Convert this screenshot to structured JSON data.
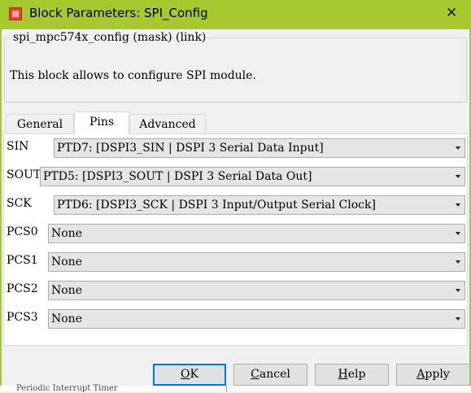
{
  "window": {
    "title": "Block Parameters: SPI_Config",
    "close_glyph": "✕"
  },
  "mask": {
    "group_title": "spi_mpc574x_config (mask) (link)",
    "description": "This block allows to configure SPI module."
  },
  "tabs": [
    {
      "label": "General",
      "active": false
    },
    {
      "label": "Pins",
      "active": true
    },
    {
      "label": "Advanced",
      "active": false
    }
  ],
  "pins": [
    {
      "label": "SIN",
      "value": "PTD7: [DSPI3_SIN | DSPI 3 Serial Data Input]"
    },
    {
      "label": "SOUT",
      "value": "PTD5: [DSPI3_SOUT | DSPI 3 Serial Data Out]"
    },
    {
      "label": "SCK",
      "value": "PTD6: [DSPI3_SCK | DSPI 3 Input/Output Serial Clock]"
    },
    {
      "label": "PCS0",
      "value": "None"
    },
    {
      "label": "PCS1",
      "value": "None"
    },
    {
      "label": "PCS2",
      "value": "None"
    },
    {
      "label": "PCS3",
      "value": "None"
    }
  ],
  "buttons": {
    "ok": {
      "mnemonic": "O",
      "rest": "K"
    },
    "cancel": {
      "mnemonic": "C",
      "rest": "ancel"
    },
    "help": {
      "mnemonic": "H",
      "rest": "elp"
    },
    "apply": {
      "mnemonic": "A",
      "rest": "pply"
    }
  },
  "background_text": "Periodic Interrupt Timer",
  "colors": {
    "titlebar": "#a6c930",
    "default_button_border": "#0078d7"
  }
}
